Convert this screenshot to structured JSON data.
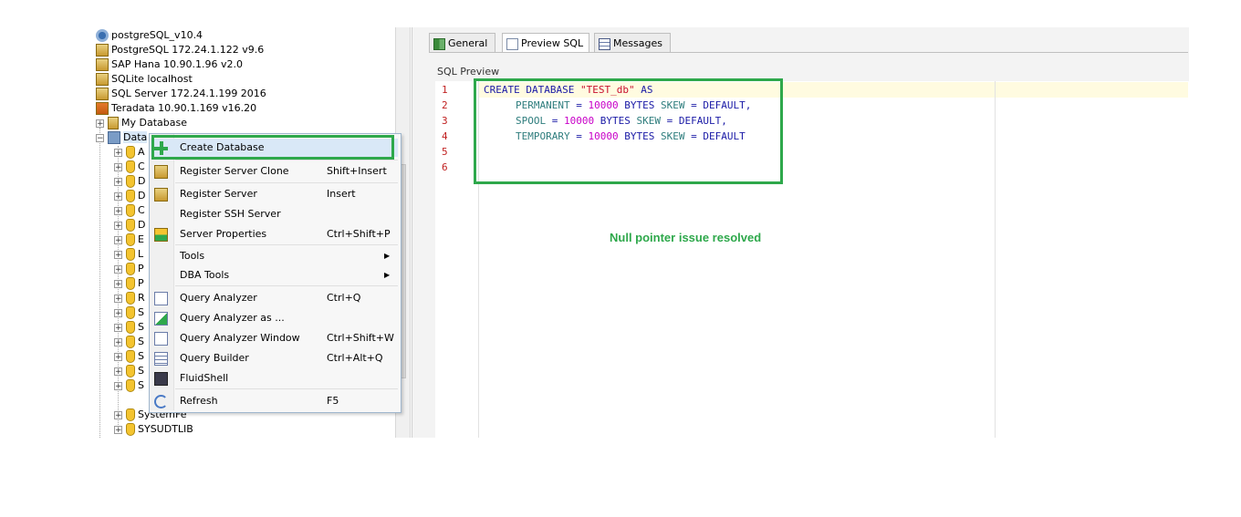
{
  "tree": {
    "servers": [
      {
        "label": "postgreSQL_v10.4"
      },
      {
        "label": "PostgreSQL 172.24.1.122 v9.6"
      },
      {
        "label": "SAP Hana 10.90.1.96 v2.0"
      },
      {
        "label": "SQLite localhost"
      },
      {
        "label": "SQL Server 172.24.1.199 2016"
      },
      {
        "label": "Teradata 10.90.1.169 v16.20"
      }
    ],
    "my_database": "My Database",
    "databases_node": "Data",
    "children_partial": [
      "A",
      "C",
      "D",
      "D",
      "C",
      "D",
      "E",
      "L",
      "P",
      "P",
      "R",
      "S",
      "S",
      "S",
      "S",
      "S",
      "S"
    ],
    "children_full": [
      "SystemFe",
      "SYSUDTLIB"
    ]
  },
  "tabs": [
    {
      "label": "General",
      "icon": "grid-icon",
      "active": false
    },
    {
      "label": "Preview SQL",
      "icon": "document-icon",
      "active": true
    },
    {
      "label": "Messages",
      "icon": "table-icon",
      "active": false
    }
  ],
  "preview": {
    "label": "SQL Preview",
    "line_numbers": [
      "1",
      "2",
      "3",
      "4",
      "5",
      "6"
    ],
    "code": {
      "l1_kw": "CREATE DATABASE ",
      "l1_str": "\"TEST_db\"",
      "l1_kw2": " AS",
      "l2_id": "PERMANENT",
      "l2_eq": " = ",
      "l2_num": "10000",
      "l2_rest": " BYTES ",
      "l2_id2": "SKEW",
      "l2_tail": " = DEFAULT,",
      "l3_id": "SPOOL",
      "l3_eq": " = ",
      "l3_num": "10000",
      "l3_rest": " BYTES ",
      "l3_id2": "SKEW",
      "l3_tail": " = DEFAULT,",
      "l4_id": "TEMPORARY",
      "l4_eq": " = ",
      "l4_num": "10000",
      "l4_rest": " BYTES ",
      "l4_id2": "SKEW",
      "l4_tail": " = DEFAULT"
    },
    "annotation": "Null pointer issue resolved"
  },
  "context_menu": {
    "items": [
      {
        "label": "Create Database",
        "shortcut": "",
        "icon": "plus-icon"
      },
      {
        "label": "Register Server Clone",
        "shortcut": "Shift+Insert",
        "icon": "server-clone-icon"
      },
      {
        "label": "Register Server",
        "shortcut": "Insert",
        "icon": "server-add-icon"
      },
      {
        "label": "Register SSH Server",
        "shortcut": "",
        "icon": ""
      },
      {
        "label": "Server Properties",
        "shortcut": "Ctrl+Shift+P",
        "icon": "properties-icon"
      },
      {
        "label": "Tools",
        "shortcut": "",
        "submenu": true
      },
      {
        "label": "DBA Tools",
        "shortcut": "",
        "submenu": true
      },
      {
        "label": "Query Analyzer",
        "shortcut": "Ctrl+Q",
        "icon": "query-analyzer-icon"
      },
      {
        "label": "Query Analyzer as ...",
        "shortcut": "",
        "icon": "query-analyzer-as-icon"
      },
      {
        "label": "Query Analyzer Window",
        "shortcut": "Ctrl+Shift+W",
        "icon": "query-window-icon"
      },
      {
        "label": "Query Builder",
        "shortcut": "Ctrl+Alt+Q",
        "icon": "query-builder-icon"
      },
      {
        "label": "FluidShell",
        "shortcut": "",
        "icon": "terminal-icon"
      },
      {
        "label": "Refresh",
        "shortcut": "F5",
        "icon": "refresh-icon"
      }
    ]
  },
  "colors": {
    "highlight_green": "#2ea84b",
    "selection": "#d9e8f7"
  }
}
